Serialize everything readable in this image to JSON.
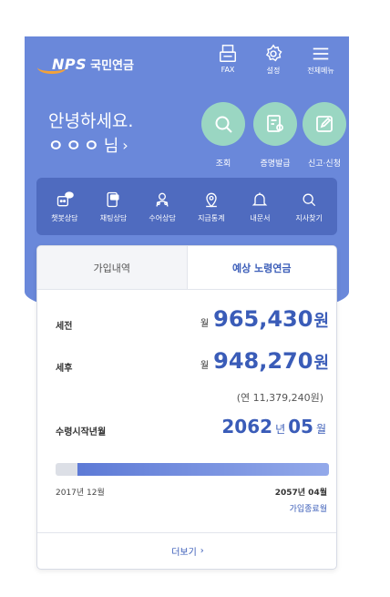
{
  "header": {
    "logo_en": "NPS",
    "logo_kr": "국민연금",
    "icons": [
      {
        "name": "fax-icon",
        "label": "FAX"
      },
      {
        "name": "settings-icon",
        "label": "설정"
      },
      {
        "name": "menu-icon",
        "label": "전체메뉴"
      }
    ]
  },
  "greeting": "안녕하세요.",
  "user": {
    "masked_name": "ㅇㅇㅇ",
    "suffix": "님",
    "chevron": "›"
  },
  "quick_actions": [
    {
      "name": "search-icon",
      "label": "조회"
    },
    {
      "name": "certificate-icon",
      "label": "증명발급"
    },
    {
      "name": "edit-icon",
      "label": "신고·신청"
    }
  ],
  "services": [
    {
      "name": "chatbot-icon",
      "label": "챗봇상담"
    },
    {
      "name": "chat-icon",
      "label": "채팅상담"
    },
    {
      "name": "sign-language-icon",
      "label": "수어상담"
    },
    {
      "name": "location-icon",
      "label": "지급통계"
    },
    {
      "name": "bell-icon",
      "label": "내문서"
    },
    {
      "name": "search-icon",
      "label": "지사찾기"
    }
  ],
  "card": {
    "tabs": [
      {
        "label": "가입내역",
        "active": false
      },
      {
        "label": "예상 노령연금",
        "active": true
      }
    ],
    "pretax": {
      "label": "세전",
      "prefix": "월",
      "amount": "965,430",
      "unit": "원"
    },
    "aftertax": {
      "label": "세후",
      "prefix": "월",
      "amount": "948,270",
      "unit": "원"
    },
    "annual": "(연 11,379,240원)",
    "start": {
      "label": "수령시작년월",
      "year": "2062",
      "year_unit": "년",
      "month": "05",
      "month_unit": "월"
    },
    "progress": {
      "fraction": 0.92,
      "start_label": "2017년 12월",
      "end_label": "2057년 04월",
      "end_caption": "가입종료월"
    },
    "more_label": "더보기",
    "more_chevron": "›"
  },
  "colors": {
    "primary": "#6a88da",
    "accent": "#3a5cb8",
    "mint": "#9ad6c2",
    "bar": "#4f6bbf"
  }
}
